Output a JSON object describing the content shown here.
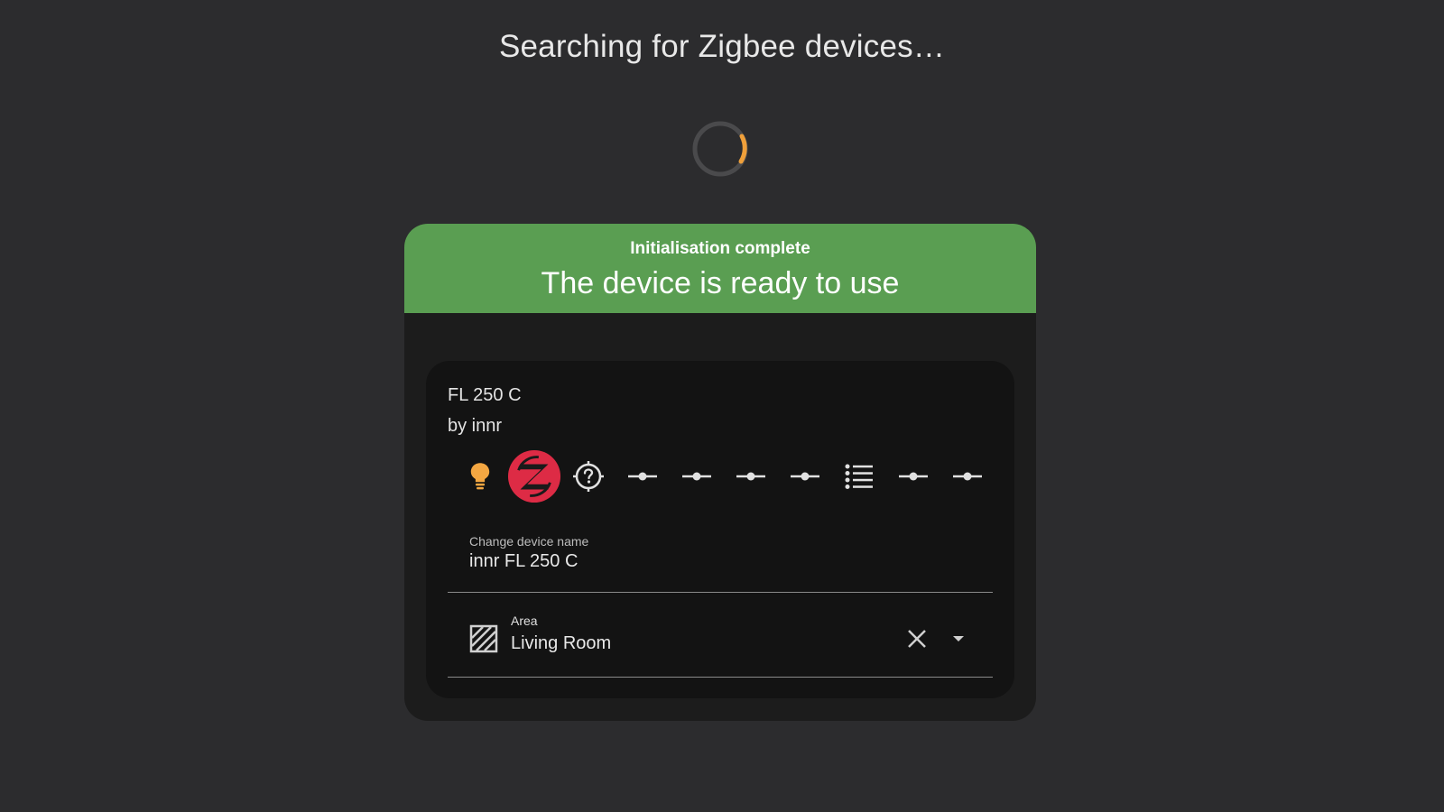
{
  "heading": "Searching for Zigbee devices…",
  "spinner": {
    "track_color": "#4a4a4c",
    "accent_color": "#f0a03a"
  },
  "banner": {
    "subtitle": "Initialisation complete",
    "title": "The device is ready to use",
    "color": "#5a9e52"
  },
  "device": {
    "model": "FL 250 C",
    "manufacturer": "by innr",
    "entities": [
      {
        "icon": "lightbulb-icon",
        "color": "#f4a742"
      },
      {
        "icon": "zigbee-logo-icon",
        "color": "#dd2b45"
      },
      {
        "icon": "crosshairs-question-icon",
        "color": "#e1e1e1"
      },
      {
        "icon": "ray-vertex-icon",
        "color": "#e1e1e1"
      },
      {
        "icon": "ray-vertex-icon",
        "color": "#e1e1e1"
      },
      {
        "icon": "ray-vertex-icon",
        "color": "#e1e1e1"
      },
      {
        "icon": "ray-vertex-icon",
        "color": "#e1e1e1"
      },
      {
        "icon": "format-list-bulleted-icon",
        "color": "#e1e1e1"
      },
      {
        "icon": "ray-vertex-icon",
        "color": "#e1e1e1"
      },
      {
        "icon": "ray-vertex-icon",
        "color": "#e1e1e1"
      }
    ]
  },
  "name_field": {
    "label": "Change device name",
    "value": "innr FL 250 C"
  },
  "area_field": {
    "icon": "texture-box-icon",
    "label": "Area",
    "value": "Living Room",
    "clear_icon": "close-icon",
    "dropdown_icon": "menu-down-icon"
  }
}
